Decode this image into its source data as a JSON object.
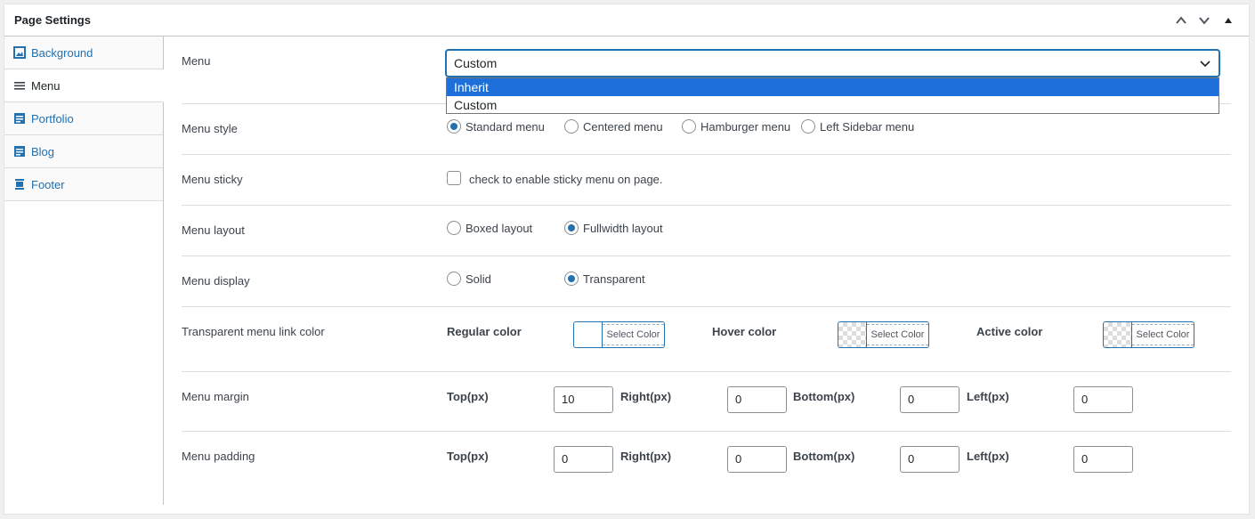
{
  "panel": {
    "title": "Page Settings",
    "controls": [
      "chevron-up-icon",
      "chevron-down-icon",
      "triangle-up-icon"
    ]
  },
  "sidebar": {
    "tabs": [
      {
        "label": "Background",
        "icon": "image-icon",
        "active": false
      },
      {
        "label": "Menu",
        "icon": "menu-lines-icon",
        "active": true
      },
      {
        "label": "Portfolio",
        "icon": "portfolio-icon",
        "active": false
      },
      {
        "label": "Blog",
        "icon": "blog-icon",
        "active": false
      },
      {
        "label": "Footer",
        "icon": "footer-icon",
        "active": false
      }
    ]
  },
  "menu_select": {
    "label": "Menu",
    "value": "Custom",
    "options": [
      "Inherit",
      "Custom"
    ],
    "highlighted": "Inherit"
  },
  "menu_style": {
    "label": "Menu style",
    "options": [
      "Standard menu",
      "Centered menu",
      "Hamburger menu",
      "Left Sidebar menu"
    ],
    "selected": "Standard menu"
  },
  "menu_sticky": {
    "label": "Menu sticky",
    "checkbox_text": "check to enable sticky menu on page.",
    "checked": false
  },
  "menu_layout": {
    "label": "Menu layout",
    "options": [
      "Boxed layout",
      "Fullwidth layout"
    ],
    "selected": "Fullwidth layout"
  },
  "menu_display": {
    "label": "Menu display",
    "options": [
      "Solid",
      "Transparent"
    ],
    "selected": "Transparent"
  },
  "link_color": {
    "label": "Transparent menu link color",
    "pickers": [
      {
        "label": "Regular color",
        "button": "Select Color"
      },
      {
        "label": "Hover color",
        "button": "Select Color"
      },
      {
        "label": "Active color",
        "button": "Select Color"
      }
    ]
  },
  "menu_margin": {
    "label": "Menu margin",
    "fields": [
      {
        "label": "Top(px)",
        "value": "10"
      },
      {
        "label": "Right(px)",
        "value": "0"
      },
      {
        "label": "Bottom(px)",
        "value": "0"
      },
      {
        "label": "Left(px)",
        "value": "0"
      }
    ]
  },
  "menu_padding": {
    "label": "Menu padding",
    "fields": [
      {
        "label": "Top(px)",
        "value": "0"
      },
      {
        "label": "Right(px)",
        "value": "0"
      },
      {
        "label": "Bottom(px)",
        "value": "0"
      },
      {
        "label": "Left(px)",
        "value": "0"
      }
    ]
  },
  "colors": {
    "accent": "#2271b1",
    "highlight": "#1e6fd9",
    "border": "#dcdcde"
  }
}
